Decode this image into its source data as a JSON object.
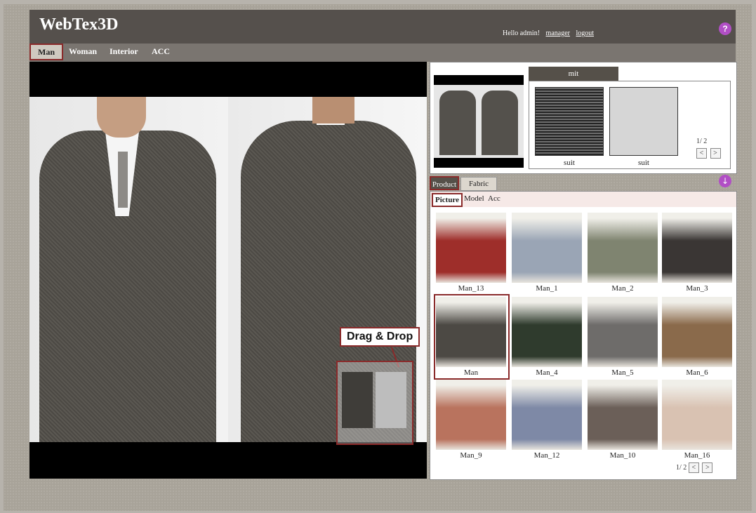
{
  "app_title": "WebTex3D",
  "header": {
    "hello": "Hello admin!",
    "links": [
      "manager",
      "logout"
    ],
    "help_icon": "?"
  },
  "nav": [
    "Man",
    "Woman",
    "Interior",
    "ACC"
  ],
  "preview": {
    "drag_label": "Drag & Drop"
  },
  "fabric_panel": {
    "tab_label": "mit",
    "swatches": [
      {
        "label": "suit"
      },
      {
        "label": "suit"
      }
    ],
    "pager": "1/ 2",
    "prev": "<",
    "next": ">"
  },
  "tabs": [
    "Product",
    "Fabric"
  ],
  "download_icon": "↓",
  "subtabs": [
    "Picture",
    "Model",
    "Acc"
  ],
  "products": [
    {
      "label": "Man_13",
      "color": "#9e2e2a"
    },
    {
      "label": "Man_1",
      "color": "#9aa5b5"
    },
    {
      "label": "Man_2",
      "color": "#7f8470"
    },
    {
      "label": "Man_3",
      "color": "#3a3634"
    },
    {
      "label": "Man",
      "color": "#4c4944"
    },
    {
      "label": "Man_4",
      "color": "#2f3b2d"
    },
    {
      "label": "Man_5",
      "color": "#6e6c6a"
    },
    {
      "label": "Man_6",
      "color": "#8a6a4b"
    },
    {
      "label": "Man_9",
      "color": "#b9735e"
    },
    {
      "label": "Man_12",
      "color": "#7e89a6"
    },
    {
      "label": "Man_10",
      "color": "#6b5f58"
    },
    {
      "label": "Man_16",
      "color": "#d9c2b2"
    }
  ],
  "product_pager": "1/ 2",
  "product_prev": "<",
  "product_next": ">"
}
